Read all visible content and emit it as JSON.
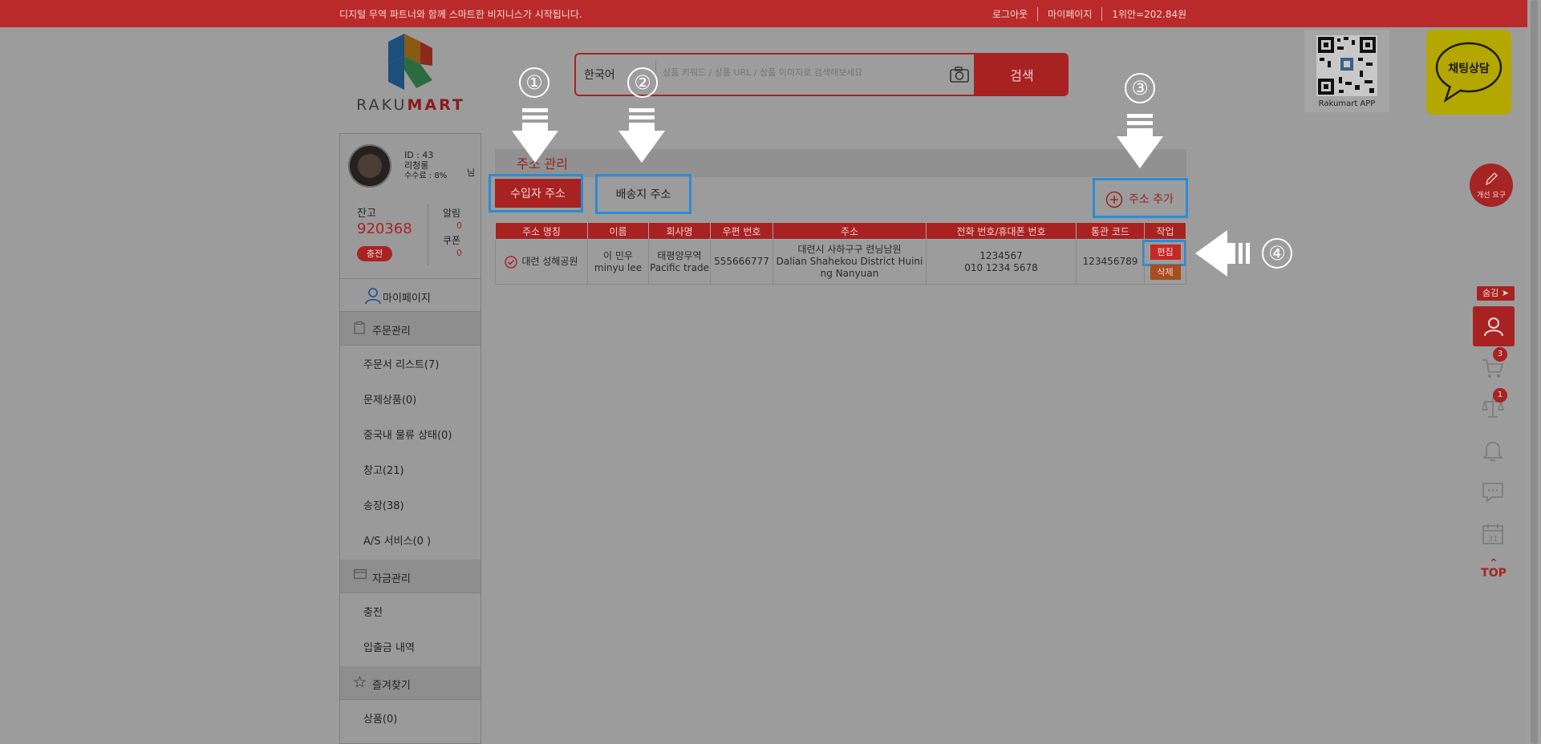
{
  "topbar": {
    "slogan": "디지털 무역 파트너와 함께 스마트한 비지니스가 시작됩니다.",
    "logout": "로그아웃",
    "mypage": "마이페이지",
    "rate": "1위안=202.84원"
  },
  "logo": {
    "text_a": "RAKU",
    "text_b": "MART"
  },
  "search": {
    "language": "한국어",
    "placeholder": "상품 키워드 / 상품 URL / 상품 이미지로 검색해보세요",
    "button": "검색"
  },
  "app": {
    "caption": "Rakumart APP"
  },
  "chat": {
    "label": "채팅상담"
  },
  "profile": {
    "id": "ID : 43",
    "name": "리청롱",
    "fee": "수수료 : 8%",
    "honorific": "님",
    "balance_label": "잔고",
    "balance": "920368",
    "charge_button": "충전",
    "alarm_label": "알림",
    "alarm_count": "0",
    "coupon_label": "쿠폰",
    "coupon_count": "0"
  },
  "sidebar": {
    "mypage": "마이페이지",
    "order_section": "주문관리",
    "order_items": [
      "주문서 리스트(7)",
      "문제상품(0)",
      "중국내 물류 상태(0)",
      "창고(21)",
      "송장(38)",
      "A/S 서비스(0 )"
    ],
    "fund_section": "자금관리",
    "fund_items": [
      "충전",
      "입출금 내역"
    ],
    "fav_section": "즐겨찾기",
    "fav_items": [
      "상품(0)"
    ]
  },
  "main": {
    "title": "주소 관리",
    "tab_importer": "수입자 주소",
    "tab_delivery": "배송지 주소",
    "add_address": "주소 추가"
  },
  "table": {
    "headers": [
      "주소 명칭",
      "이름",
      "회사명",
      "우편 번호",
      "주소",
      "전화 번호/휴대폰 번호",
      "통관 코드",
      "작업"
    ],
    "row": {
      "label": "대련 성해공원",
      "name_ko": "이 민우",
      "name_en": "minyu lee",
      "company_ko": "태평양무역",
      "company_en": "Pacific trade",
      "zip": "555666777",
      "address_ko": "대련시 사하구구 련닝남원",
      "address_en": "Dalian Shahekou District Huining Nanyuan",
      "phone": "1234567",
      "mobile": "010 1234 5678",
      "customs_code": "123456789",
      "edit": "편집",
      "delete": "삭제"
    }
  },
  "steps": [
    "①",
    "②",
    "③",
    "④"
  ],
  "right_rail": {
    "suggest": "개선 요구",
    "hide": "숨김 ➤",
    "cart_badge": "3",
    "compare_badge": "1",
    "calendar_day": "31",
    "top": "TOP"
  },
  "colors": {
    "brand_red": "#a82222",
    "highlight_blue": "#2b8bd6"
  }
}
